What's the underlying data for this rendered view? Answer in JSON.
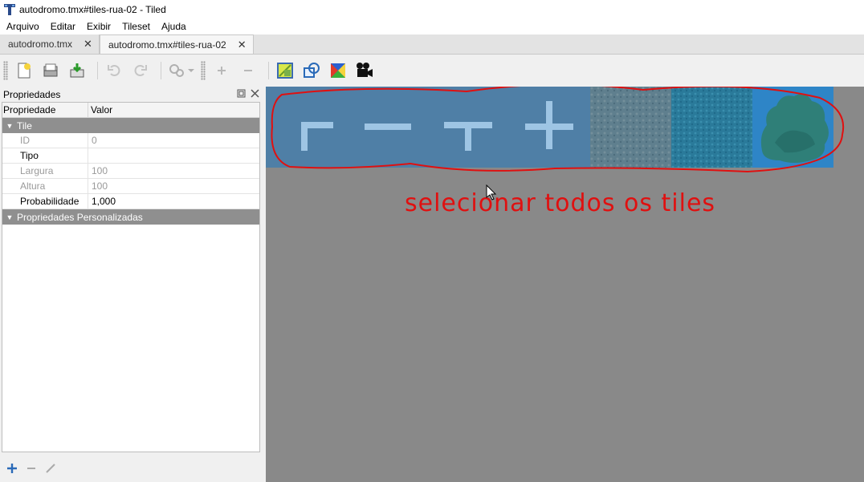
{
  "window": {
    "title": "autodromo.tmx#tiles-rua-02 - Tiled",
    "app_icon": "tiled-app-icon"
  },
  "menu": {
    "items": [
      "Arquivo",
      "Editar",
      "Exibir",
      "Tileset",
      "Ajuda"
    ]
  },
  "tabs": [
    {
      "label": "autodromo.tmx",
      "active": false
    },
    {
      "label": "autodromo.tmx#tiles-rua-02",
      "active": true
    }
  ],
  "toolbar": {
    "buttons": [
      "new-file-icon",
      "open-file-icon",
      "save-icon",
      "undo-icon",
      "redo-icon",
      "settings-icon",
      "add-icon",
      "remove-icon",
      "tileset-image-icon",
      "collision-shapes-icon",
      "terrain-icon",
      "animation-editor-icon"
    ]
  },
  "properties_panel": {
    "title": "Propriedades",
    "header": {
      "col1": "Propriedade",
      "col2": "Valor"
    },
    "group_tile": "Tile",
    "rows": [
      {
        "key": "ID",
        "value": "0",
        "disabled": true
      },
      {
        "key": "Tipo",
        "value": "",
        "disabled": false
      },
      {
        "key": "Largura",
        "value": "100",
        "disabled": true
      },
      {
        "key": "Altura",
        "value": "100",
        "disabled": true
      },
      {
        "key": "Probabilidade",
        "value": "1,000",
        "disabled": false
      }
    ],
    "group_custom": "Propriedades Personalizadas"
  },
  "canvas": {
    "annotation": "selecionar todos os tiles",
    "tiles": [
      "road-corner-tile",
      "road-horizontal-tile",
      "road-t-junction-tile",
      "road-cross-tile",
      "stone-texture-tile",
      "water-texture-tile",
      "bush-tile"
    ]
  },
  "colors": {
    "selection": "#2e85c7",
    "annotation": "#e01010",
    "canvas_bg": "#898989"
  }
}
